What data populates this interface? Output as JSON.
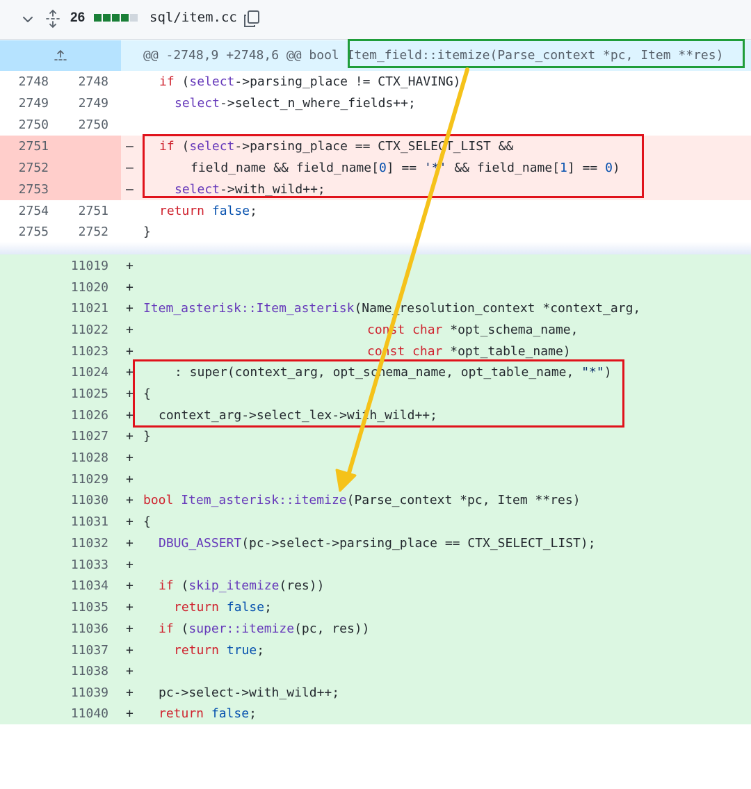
{
  "file_header": {
    "changes_count": "26",
    "diffstat_colors": [
      "#1a7f37",
      "#1a7f37",
      "#1a7f37",
      "#1a7f37",
      "#d0d7de"
    ],
    "filename": "sql/item.cc",
    "icons": [
      "chevron-down-icon",
      "expand-all-icon",
      "copy-icon"
    ]
  },
  "hunk": {
    "header": "@@ -2748,9 +2748,6 @@ bool Item_field::itemize(Parse_context *pc, Item **res)"
  },
  "context_lines": [
    {
      "old": "2748",
      "new": "2748",
      "marker": "",
      "type": "ctx"
    },
    {
      "old": "2749",
      "new": "2749",
      "marker": "",
      "type": "ctx"
    },
    {
      "old": "2750",
      "new": "2750",
      "marker": "",
      "type": "ctx"
    },
    {
      "old": "2751",
      "new": "",
      "marker": "–",
      "type": "del"
    },
    {
      "old": "2752",
      "new": "",
      "marker": "–",
      "type": "del"
    },
    {
      "old": "2753",
      "new": "",
      "marker": "–",
      "type": "del"
    },
    {
      "old": "2754",
      "new": "2751",
      "marker": "",
      "type": "ctx"
    },
    {
      "old": "2755",
      "new": "2752",
      "marker": "",
      "type": "ctx"
    }
  ],
  "added_lines": [
    {
      "new": "11019",
      "marker": "+"
    },
    {
      "new": "11020",
      "marker": "+"
    },
    {
      "new": "11021",
      "marker": "+"
    },
    {
      "new": "11022",
      "marker": "+"
    },
    {
      "new": "11023",
      "marker": "+"
    },
    {
      "new": "11024",
      "marker": "+"
    },
    {
      "new": "11025",
      "marker": "+"
    },
    {
      "new": "11026",
      "marker": "+"
    },
    {
      "new": "11027",
      "marker": "+"
    },
    {
      "new": "11028",
      "marker": "+"
    },
    {
      "new": "11029",
      "marker": "+"
    },
    {
      "new": "11030",
      "marker": "+"
    },
    {
      "new": "11031",
      "marker": "+"
    },
    {
      "new": "11032",
      "marker": "+"
    },
    {
      "new": "11033",
      "marker": "+"
    },
    {
      "new": "11034",
      "marker": "+"
    },
    {
      "new": "11035",
      "marker": "+"
    },
    {
      "new": "11036",
      "marker": "+"
    },
    {
      "new": "11037",
      "marker": "+"
    },
    {
      "new": "11038",
      "marker": "+"
    },
    {
      "new": "11039",
      "marker": "+"
    },
    {
      "new": "11040",
      "marker": "+"
    }
  ],
  "code": {
    "l2748": {
      "kw": "if",
      "a": " (",
      "fn": "select",
      "b": "->parsing_place != CTX_HAVING)"
    },
    "l2749": {
      "fn": "select",
      "b": "->select_n_where_fields++;"
    },
    "l2751": {
      "kw": "if",
      "a": " (",
      "fn": "select",
      "b": "->parsing_place == CTX_SELECT_LIST &&"
    },
    "l2752": {
      "a": "field_name && field_name[",
      "n1": "0",
      "b": "] == ",
      "str": "'*'",
      "c": " && field_name[",
      "n2": "1",
      "d": "] == ",
      "n3": "0",
      "e": ")"
    },
    "l2753": {
      "fn": "select",
      "b": "->with_wild++;"
    },
    "l2754": {
      "kw": "return",
      "sp": " ",
      "val": "false",
      "b": ";"
    },
    "l2755": {
      "b": "}"
    },
    "l11021": {
      "fn": "Item_asterisk::Item_asterisk",
      "b": "(Name_resolution_context *context_arg,"
    },
    "l11022": {
      "kw1": "const",
      "sp": " ",
      "kw2": "char",
      "b": " *opt_schema_name,"
    },
    "l11023": {
      "kw1": "const",
      "sp": " ",
      "kw2": "char",
      "b": " *opt_table_name)"
    },
    "l11024": {
      "a": ": super(context_arg, opt_schema_name, opt_table_name, ",
      "str": "\"*\"",
      "b": ")"
    },
    "l11025": {
      "b": "{"
    },
    "l11026": {
      "b": "context_arg->select_lex->with_wild++;"
    },
    "l11027": {
      "b": "}"
    },
    "l11030": {
      "kw": "bool",
      "sp": " ",
      "fn": "Item_asterisk::itemize",
      "b": "(Parse_context *pc, Item **res)"
    },
    "l11031": {
      "b": "{"
    },
    "l11032": {
      "fn": "DBUG_ASSERT",
      "b": "(pc->select->parsing_place == CTX_SELECT_LIST);"
    },
    "l11034": {
      "kw": "if",
      "a": " (",
      "fn": "skip_itemize",
      "b": "(res))"
    },
    "l11035": {
      "kw": "return",
      "sp": " ",
      "val": "false",
      "b": ";"
    },
    "l11036": {
      "kw": "if",
      "a": " (",
      "fn": "super::itemize",
      "b": "(pc, res))"
    },
    "l11037": {
      "kw": "return",
      "sp": " ",
      "val": "true",
      "b": ";"
    },
    "l11039": {
      "b": "pc->select->with_wild++;"
    },
    "l11040": {
      "kw": "return",
      "sp": " ",
      "val": "false",
      "b": ";"
    }
  },
  "annotations": {
    "green_box_color": "#1f9d3a",
    "red_box_color": "#e0121b",
    "arrow_color": "#f5c21a"
  }
}
